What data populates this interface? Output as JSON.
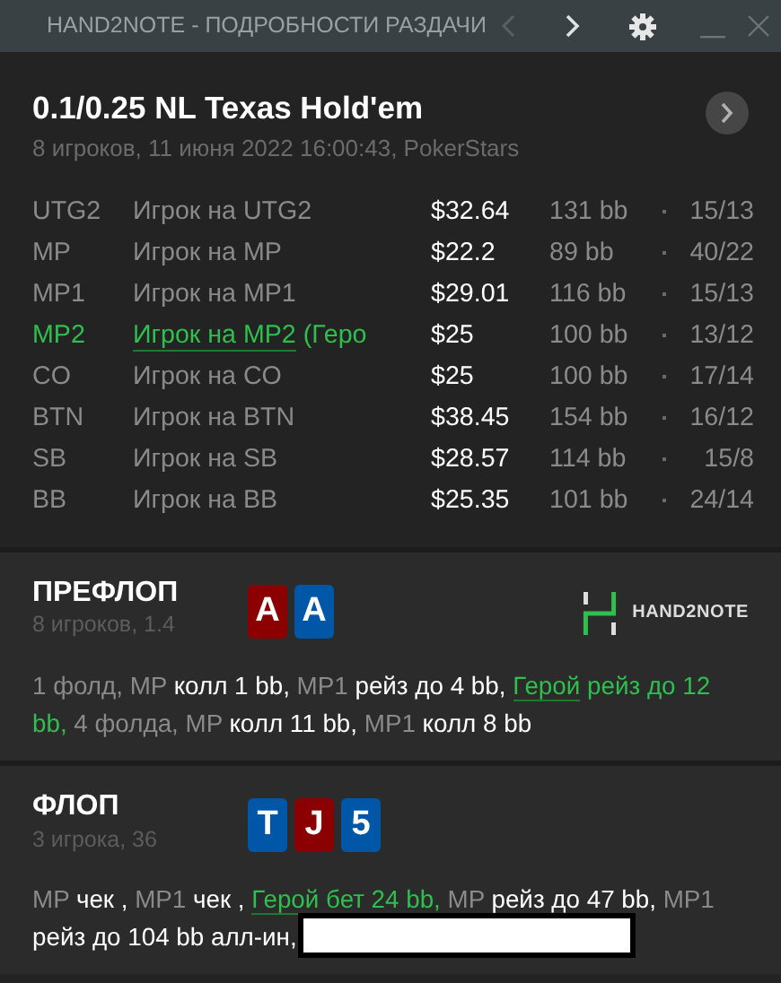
{
  "window": {
    "title": "HAND2NOTE - ПОДРОБНОСТИ РАЗДАЧИ",
    "prev_disabled": true
  },
  "hand": {
    "title": "0.1/0.25 NL Texas Hold'em",
    "subtitle": "8 игроков, 11 июня 2022 16:00:43, PokerStars"
  },
  "players": [
    {
      "position": "UTG2",
      "player": "Игрок на UTG2",
      "stack": "$32.64",
      "bb": "131 bb",
      "stats": "15/13",
      "hero": false
    },
    {
      "position": "MP",
      "player": "Игрок на MP",
      "stack": "$22.2",
      "bb": "89 bb",
      "stats": "40/22",
      "hero": false
    },
    {
      "position": "MP1",
      "player": "Игрок на MP1",
      "stack": "$29.01",
      "bb": "116 bb",
      "stats": "15/13",
      "hero": false
    },
    {
      "position": "MP2",
      "player": "Игрок на MP2",
      "note": "(Геро",
      "stack": "$25",
      "bb": "100 bb",
      "stats": "13/12",
      "hero": true
    },
    {
      "position": "CO",
      "player": "Игрок на CO",
      "stack": "$25",
      "bb": "100 bb",
      "stats": "17/14",
      "hero": false
    },
    {
      "position": "BTN",
      "player": "Игрок на BTN",
      "stack": "$38.45",
      "bb": "154 bb",
      "stats": "16/12",
      "hero": false
    },
    {
      "position": "SB",
      "player": "Игрок на SB",
      "stack": "$28.57",
      "bb": "114 bb",
      "stats": "15/8",
      "hero": false
    },
    {
      "position": "BB",
      "player": "Игрок на BB",
      "stack": "$25.35",
      "bb": "101 bb",
      "stats": "24/14",
      "hero": false
    }
  ],
  "streets": [
    {
      "name": "ПРЕФЛОП",
      "info": "8 игроков, 1.4",
      "logo": "HAND2NOTE",
      "cards": [
        {
          "rank": "A",
          "color": "#8b0000"
        },
        {
          "rank": "A",
          "color": "#0057a8"
        }
      ],
      "actions": [
        {
          "kind": "pos",
          "text": "1 фолд, MP "
        },
        {
          "kind": "act",
          "text": "колл 1 bb, "
        },
        {
          "kind": "pos",
          "text": "MP1 "
        },
        {
          "kind": "act",
          "text": "рейз до 4 bb, "
        },
        {
          "kind": "hero",
          "text": "Герой"
        },
        {
          "kind": "heroact",
          "text": " рейз до 12 bb, "
        },
        {
          "kind": "pos",
          "text": "4 фолда, MP "
        },
        {
          "kind": "act",
          "text": "колл 11 bb, "
        },
        {
          "kind": "pos",
          "text": "MP1 "
        },
        {
          "kind": "act",
          "text": "колл 8 bb"
        }
      ]
    },
    {
      "name": "ФЛОП",
      "info": "3 игрока, 36",
      "cards": [
        {
          "rank": "T",
          "color": "#0057a8"
        },
        {
          "rank": "J",
          "color": "#8b0000"
        },
        {
          "rank": "5",
          "color": "#0057a8"
        }
      ],
      "actions": [
        {
          "kind": "pos",
          "text": "MP "
        },
        {
          "kind": "act",
          "text": "чек , "
        },
        {
          "kind": "pos",
          "text": "MP1 "
        },
        {
          "kind": "act",
          "text": "чек , "
        },
        {
          "kind": "hero",
          "text": "Герой"
        },
        {
          "kind": "heroact",
          "text": " бет 24 bb, "
        },
        {
          "kind": "pos",
          "text": "MP "
        },
        {
          "kind": "act",
          "text": "рейз до 47 bb, "
        },
        {
          "kind": "pos",
          "text": "MP1 "
        },
        {
          "kind": "act",
          "text": "рейз до 104 bb алл-ин, "
        },
        {
          "kind": "redacted"
        }
      ]
    }
  ]
}
